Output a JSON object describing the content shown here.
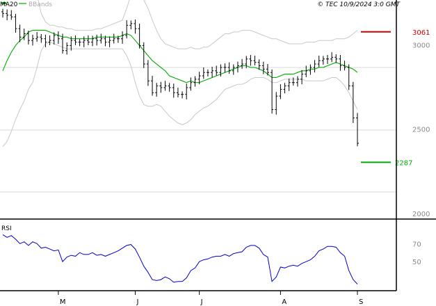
{
  "header": {
    "legend_ma": "MA20",
    "legend_bb": "BBands",
    "stamp": "© TEC 10/9/2024 3:0 GMT"
  },
  "colors": {
    "ma": "#00aa00",
    "bbands": "#c8c8c8",
    "price": "#000000",
    "resistance": "#cc0000",
    "support": "#00aa00",
    "rsi": "#0000cc",
    "grid": "#d8d8d8",
    "axis_text": "#888888"
  },
  "chart_data": [
    {
      "type": "ohlc",
      "legend": [
        "MA20",
        "BBands"
      ],
      "ylim": [
        1950,
        3250
      ],
      "yticks": [
        {
          "value": 3000,
          "label": "3000"
        },
        {
          "value": 2500,
          "label": "2500"
        },
        {
          "value": 2000,
          "label": "2000"
        }
      ],
      "xticks": [
        {
          "index": 13,
          "label": "M"
        },
        {
          "index": 31,
          "label": "J"
        },
        {
          "index": 46,
          "label": "J"
        },
        {
          "index": 65,
          "label": "A"
        },
        {
          "index": 83,
          "label": "S"
        }
      ],
      "levels": [
        {
          "name": "resistance",
          "value": 3061,
          "label": "3061"
        },
        {
          "name": "support",
          "value": 2287,
          "label": "2287"
        }
      ],
      "close": [
        3170,
        3160,
        3150,
        3080,
        3030,
        3050,
        3010,
        3020,
        3030,
        3020,
        3000,
        3010,
        3040,
        3020,
        2950,
        2980,
        3010,
        3000,
        3000,
        3010,
        3000,
        3020,
        3010,
        3020,
        3000,
        3010,
        3020,
        3020,
        3040,
        3100,
        3110,
        3080,
        2980,
        2870,
        2770,
        2700,
        2740,
        2730,
        2740,
        2730,
        2700,
        2690,
        2690,
        2730,
        2760,
        2780,
        2800,
        2820,
        2820,
        2830,
        2820,
        2850,
        2850,
        2830,
        2850,
        2860,
        2870,
        2900,
        2890,
        2880,
        2860,
        2840,
        2820,
        2600,
        2680,
        2720,
        2740,
        2760,
        2760,
        2780,
        2810,
        2830,
        2850,
        2870,
        2890,
        2900,
        2900,
        2910,
        2900,
        2860,
        2850,
        2740,
        2550,
        2400
      ],
      "ma20": [
        2830,
        2890,
        2940,
        2980,
        3010,
        3030,
        3060,
        3070,
        3070,
        3070,
        3070,
        3060,
        3050,
        3040,
        3030,
        3030,
        3020,
        3020,
        3020,
        3020,
        3020,
        3020,
        3030,
        3030,
        3030,
        3030,
        3030,
        3030,
        3040,
        3050,
        3040,
        3010,
        2980,
        2950,
        2920,
        2890,
        2870,
        2850,
        2830,
        2800,
        2790,
        2780,
        2770,
        2760,
        2770,
        2760,
        2760,
        2770,
        2780,
        2790,
        2800,
        2810,
        2820,
        2830,
        2840,
        2850,
        2860,
        2860,
        2850,
        2850,
        2840,
        2830,
        2810,
        2790,
        2790,
        2800,
        2810,
        2810,
        2810,
        2820,
        2830,
        2830,
        2840,
        2840,
        2850,
        2850,
        2860,
        2870,
        2880,
        2870,
        2860,
        2850,
        2840,
        2820
      ],
      "bb_upper": [
        3250,
        3320,
        3380,
        3420,
        3440,
        3450,
        3440,
        3400,
        3280,
        3170,
        3120,
        3100,
        3100,
        3090,
        3090,
        3080,
        3080,
        3070,
        3070,
        3070,
        3070,
        3070,
        3080,
        3080,
        3090,
        3100,
        3110,
        3120,
        3130,
        3200,
        3280,
        3290,
        3280,
        3250,
        3200,
        3130,
        3070,
        3020,
        2990,
        2980,
        2970,
        2960,
        2960,
        2960,
        2970,
        2960,
        2960,
        2970,
        2970,
        2990,
        3010,
        3030,
        3050,
        3050,
        3060,
        3060,
        3070,
        3070,
        3070,
        3060,
        3050,
        3040,
        3030,
        3020,
        3020,
        3010,
        3000,
        2990,
        2990,
        2990,
        2990,
        3000,
        3000,
        3000,
        3010,
        3010,
        3010,
        3010,
        3020,
        3020,
        3020,
        3030,
        3050,
        3070
      ],
      "bb_lower": [
        2380,
        2410,
        2470,
        2540,
        2600,
        2650,
        2720,
        2760,
        2850,
        2950,
        2990,
        3000,
        2990,
        2980,
        2970,
        2960,
        2960,
        2960,
        2960,
        2960,
        2960,
        2960,
        2960,
        2960,
        2960,
        2960,
        2960,
        2960,
        2960,
        2920,
        2860,
        2760,
        2680,
        2630,
        2620,
        2620,
        2630,
        2620,
        2590,
        2560,
        2540,
        2520,
        2510,
        2520,
        2540,
        2570,
        2590,
        2610,
        2620,
        2640,
        2660,
        2690,
        2720,
        2730,
        2740,
        2750,
        2750,
        2760,
        2780,
        2790,
        2790,
        2790,
        2780,
        2760,
        2760,
        2770,
        2780,
        2780,
        2780,
        2780,
        2780,
        2770,
        2770,
        2770,
        2770,
        2770,
        2780,
        2790,
        2790,
        2770,
        2740,
        2700,
        2650,
        2600
      ]
    },
    {
      "type": "line",
      "legend": [
        "RSI"
      ],
      "ylim": [
        20,
        95
      ],
      "yticks": [
        {
          "value": 70,
          "label": "70"
        },
        {
          "value": 50,
          "label": "50"
        }
      ],
      "series": [
        {
          "name": "RSI",
          "values": [
            80,
            77,
            79,
            75,
            70,
            72,
            68,
            72,
            70,
            65,
            66,
            64,
            62,
            63,
            50,
            55,
            57,
            56,
            60,
            58,
            58,
            60,
            57,
            58,
            56,
            58,
            60,
            62,
            65,
            68,
            69,
            64,
            55,
            45,
            38,
            30,
            29,
            30,
            33,
            31,
            27,
            28,
            28,
            32,
            40,
            43,
            50,
            52,
            53,
            55,
            56,
            56,
            58,
            56,
            59,
            60,
            61,
            66,
            68,
            68,
            65,
            58,
            55,
            28,
            33,
            44,
            43,
            45,
            46,
            45,
            48,
            50,
            52,
            56,
            62,
            64,
            67,
            67,
            66,
            60,
            56,
            40,
            30,
            25
          ]
        }
      ]
    }
  ]
}
